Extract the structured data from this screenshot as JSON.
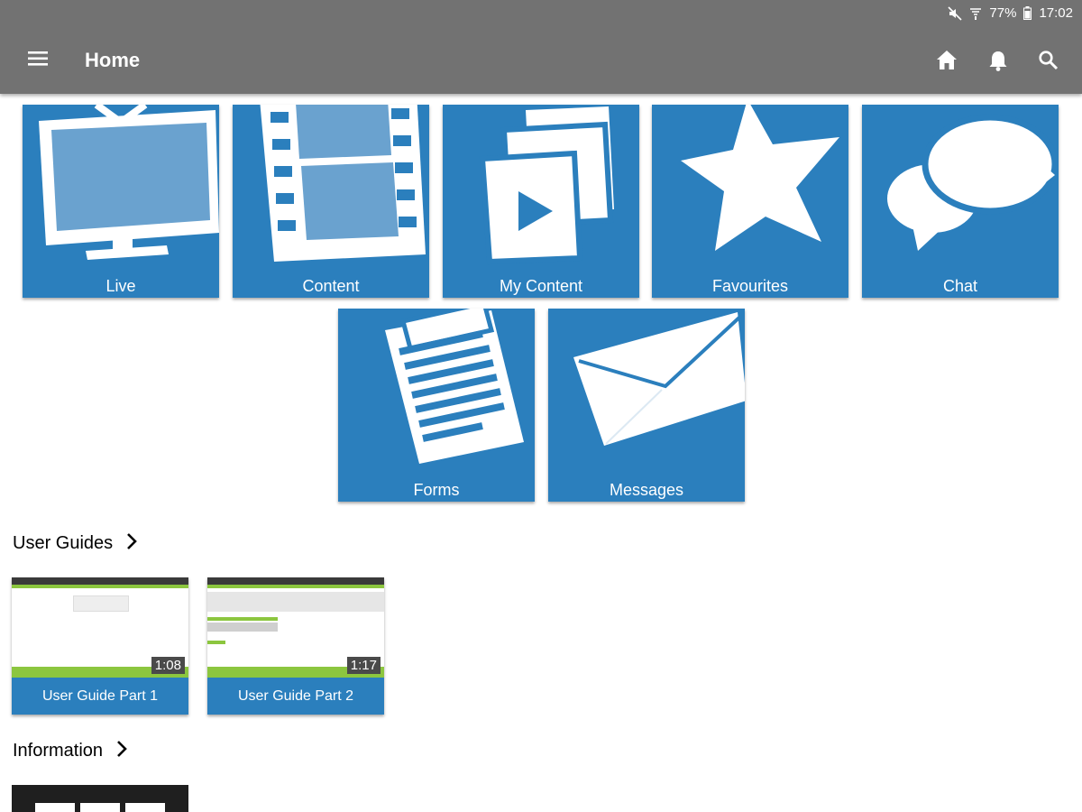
{
  "status_bar": {
    "battery": "77%",
    "time": "17:02"
  },
  "app_bar": {
    "title": "Home"
  },
  "tiles": [
    {
      "label": "Live",
      "icon": "tv-icon"
    },
    {
      "label": "Content",
      "icon": "film-strip-icon"
    },
    {
      "label": "My Content",
      "icon": "my-content-icon"
    },
    {
      "label": "Favourites",
      "icon": "star-icon"
    },
    {
      "label": "Chat",
      "icon": "chat-bubbles-icon"
    },
    {
      "label": "Forms",
      "icon": "clipboard-icon"
    },
    {
      "label": "Messages",
      "icon": "envelope-icon"
    }
  ],
  "sections": {
    "user_guides": {
      "title": "User Guides",
      "videos": [
        {
          "label": "User Guide Part 1",
          "duration": "1:08"
        },
        {
          "label": "User Guide Part 2",
          "duration": "1:17"
        }
      ]
    },
    "information": {
      "title": "Information"
    }
  },
  "colors": {
    "app_bar": "#727272",
    "tile_blue": "#2b7fbd",
    "thumb_green": "#8cc63f"
  }
}
